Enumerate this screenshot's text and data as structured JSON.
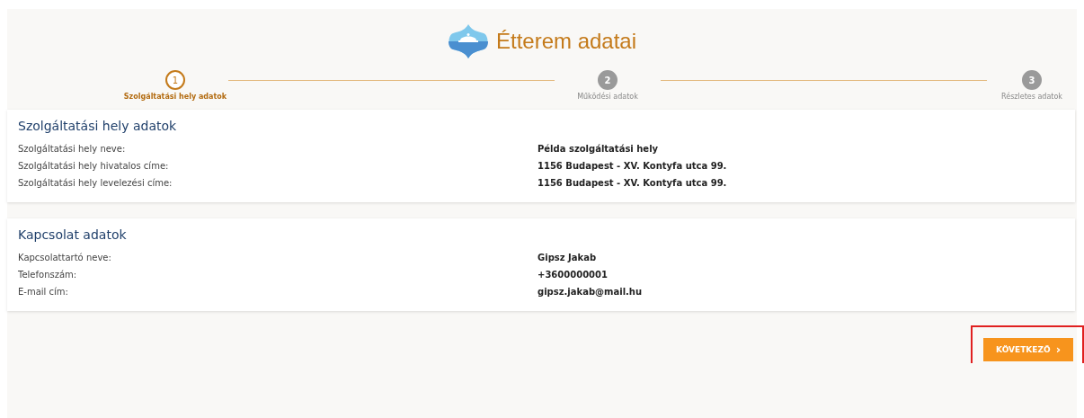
{
  "header": {
    "title": "Étterem adatai"
  },
  "steps": [
    {
      "number": "1",
      "label": "Szolgáltatási hely adatok",
      "active": true
    },
    {
      "number": "2",
      "label": "Működési adatok",
      "active": false
    },
    {
      "number": "3",
      "label": "Részletes adatok",
      "active": false
    }
  ],
  "sections": [
    {
      "title": "Szolgáltatási hely adatok",
      "rows": [
        {
          "label": "Szolgáltatási hely neve:",
          "value": "Példa szolgáltatási hely"
        },
        {
          "label": "Szolgáltatási hely hivatalos címe:",
          "value": "1156 Budapest - XV. Kontyfa utca 99."
        },
        {
          "label": "Szolgáltatási hely levelezési címe:",
          "value": "1156 Budapest - XV. Kontyfa utca 99."
        }
      ]
    },
    {
      "title": "Kapcsolat adatok",
      "rows": [
        {
          "label": "Kapcsolattartó neve:",
          "value": "Gipsz Jakab"
        },
        {
          "label": "Telefonszám:",
          "value": "+3600000001"
        },
        {
          "label": "E-mail cím:",
          "value": "gipsz.jakab@mail.hu"
        }
      ]
    }
  ],
  "next_button": {
    "label": "KÖVETKEZŐ",
    "arrow": "›",
    "highlighted": true
  }
}
